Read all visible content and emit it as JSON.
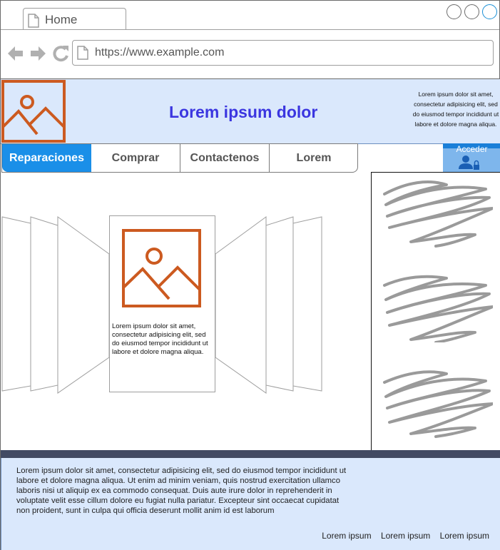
{
  "browser": {
    "tab_title": "Home",
    "url": "https://www.example.com"
  },
  "header": {
    "title": "Lorem ipsum dolor",
    "blurb": "Lorem ipsum dolor sit amet, consectetur adipisicing elit, sed do eiusmod tempor incididunt ut labore et dolore magna aliqua."
  },
  "nav": {
    "items": [
      "Reparaciones",
      "Comprar",
      "Contactenos",
      "Lorem"
    ],
    "active": "Reparaciones"
  },
  "login": {
    "label": "Acceder",
    "icon": "user-lock-icon"
  },
  "carousel": {
    "card_text": "Lorem ipsum dolor sit amet, consectetur adipisicing elit, sed do eiusmod tempor incididunt ut labore et dolore magna aliqua."
  },
  "footer": {
    "text": "Lorem ipsum dolor sit amet, consectetur adipisicing elit, sed do eiusmod tempor incididunt ut labore et dolore magna aliqua. Ut enim ad minim veniam, quis nostrud exercitation ullamco laboris nisi ut aliquip ex ea commodo consequat. Duis aute irure dolor in reprehenderit in voluptate velit esse cillum dolore eu fugiat nulla pariatur. Excepteur sint occaecat cupidatat non proident, sunt in culpa qui officia deserunt mollit anim id est laborum",
    "links": [
      "Lorem ipsum",
      "Lorem ipsum",
      "Lorem ipsum"
    ]
  },
  "colors": {
    "accent": "#1a8fe8",
    "header_bg": "#dae8fc",
    "title": "#3b36e0",
    "image_icon": "#cc5a20",
    "footer_bar": "#424a63"
  }
}
